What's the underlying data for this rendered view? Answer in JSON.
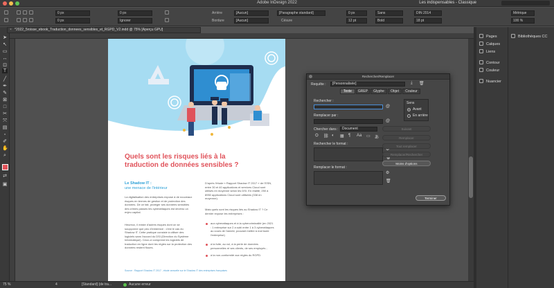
{
  "app": {
    "title": "Adobe InDesign 2022",
    "workspace": "Les indispensables - Classique",
    "search_placeholder": "Rechercher"
  },
  "controlbar": {
    "x_value": "0 px",
    "y_value": "0 px",
    "w_value": "0 px",
    "h_value": "0 px",
    "tracking": "0 px",
    "scale": "Ignorer",
    "fill_label": "Arrière",
    "stroke_label": "Bordure",
    "none1": "[Aucun]",
    "none2": "[Aucun]",
    "para_style": "[Paragraphe standard]",
    "cesure": "Césure",
    "size1": "0 px",
    "size2": "12 pt",
    "font": "Sans",
    "weight": "Bold",
    "lang": "DIN 2014",
    "size3": "18 pt",
    "metrics": "Métrique",
    "percent": "100 %"
  },
  "document": {
    "tab_label": "*2022_5roisse_ebook_Traduction_donnees_sensibles_et_RGPD_V2.indd @ 75% [Aperçu GPU]",
    "heading_line1": "Quels sont les risques liés à la",
    "heading_line2": "traduction de données sensibles ?",
    "sub_line1": "Le Shadow IT :",
    "sub_line2": "une menace de l'intérieur",
    "col1_p1": "La digitalisation des entreprises expose à de nouveaux risques en termes de gestion et de protection des données. De ce fait, protéger ses données sensibles des crimes passes les cyberattaques est devenu un enjeu capital.",
    "col1_p2": "Heureux, il existe d'autres risques dont on se soupçonne que peu d'existence : c'est le cas du Shadow IT. Cette pratique consiste à utiliser des logiciels sans l'accord du DSI (Direction du Système Informatique). Ceux-ci comprend les logiciels de traduction en ligne dont les règles sur la protection des données restent floues.",
    "col2_p1": "D'après l'étude « Rapport Shadow IT 2017 » de l'ESN, entre 30 et 40 applications et services Cloud sont utilisés en moyenne selon les DSI. En réalité, 250 à 8950 applications Cloud sont utilisées (338 en moyenne).",
    "col2_p2": "Mais quels sont les risques liés au Shadow IT ? Ce dernier expose les entreprises :",
    "bullet1": "aux cyberattaques et à la cybercriminalité (en 2021 : 1 entreprise sur 2 a subi entre 1 à 3 cyberattaques au cours de l'année, pouvant mettre à mal toute l'entreprise)",
    "bullet2": "à la fuite, au vol, à la perte de données personnelles ré ses clients, de ses employés ;",
    "bullet3": "à la non-conformité aux règles du RGPD.",
    "footnote": "Source : Rapport Shadow IT 2017 - étude annuelle sur le Shadow IT des entreprises françaises"
  },
  "statusbar": {
    "zoom": "75 %",
    "page": "4",
    "style": "[Standard] (de tra...",
    "errors": "Aucune erreur"
  },
  "panels": {
    "col1": [
      "Pages",
      "Calques",
      "Liens",
      "Contour",
      "Couleur",
      "Nuancier"
    ],
    "col2": [
      "Bibliothèques CC"
    ]
  },
  "dialog": {
    "title": "Rechercher/Remplacer",
    "query_label": "Requête :",
    "query_value": "[Personnalisée]",
    "tabs": [
      "Texte",
      "GREP",
      "Glyphe",
      "Objet",
      "Couleur"
    ],
    "search_label": "Rechercher :",
    "search_value": "",
    "replace_label": "Remplacer par :",
    "replace_value": "",
    "search_in_label": "Chercher dans :",
    "search_in_value": "Document",
    "search_format_label": "Rechercher le format :",
    "replace_format_label": "Remplacer le format :",
    "direction_label": "Sens",
    "direction_forward": "Avant",
    "direction_back": "En arrière",
    "btn_next": "Suivant",
    "btn_replace": "Remplacer",
    "btn_replace_all": "Tout remplacer",
    "btn_replace_find": "Remplacer/Rechercher",
    "btn_less": "Moins d'options",
    "btn_done": "Terminer"
  },
  "colors": {
    "accent_red": "#e0525a",
    "accent_blue": "#2a9fd6",
    "ui_dark": "#3a3a3a"
  }
}
